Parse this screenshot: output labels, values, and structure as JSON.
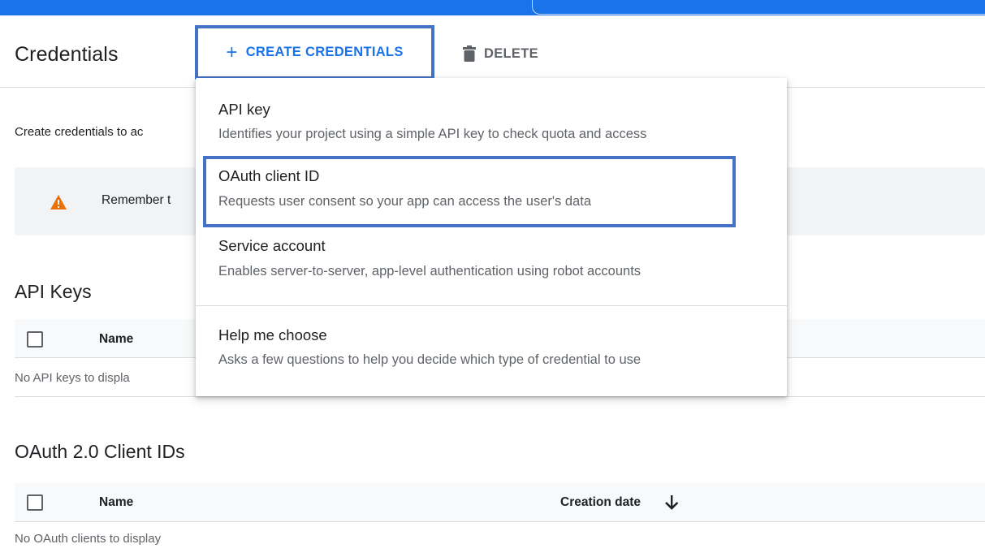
{
  "header": {
    "title": "Credentials",
    "create_label": "CREATE CREDENTIALS",
    "delete_label": "DELETE"
  },
  "intro_text": "Create credentials to ac",
  "warning": {
    "text": "Remember t",
    "color": "#e8710a"
  },
  "menu": {
    "items": [
      {
        "title": "API key",
        "description": "Identifies your project using a simple API key to check quota and access"
      },
      {
        "title": "OAuth client ID",
        "description": "Requests user consent so your app can access the user's data"
      },
      {
        "title": "Service account",
        "description": "Enables server-to-server, app-level authentication using robot accounts"
      },
      {
        "title": "Help me choose",
        "description": "Asks a few questions to help you decide which type of credential to use"
      }
    ]
  },
  "api_keys": {
    "title": "API Keys",
    "column_name": "Name",
    "empty_text": "No API keys to displa"
  },
  "oauth_clients": {
    "title": "OAuth 2.0 Client IDs",
    "column_name": "Name",
    "column_date": "Creation date",
    "empty_text": "No OAuth clients to display"
  },
  "colors": {
    "accent": "#1a73e8",
    "highlight_border": "#4472c4"
  }
}
